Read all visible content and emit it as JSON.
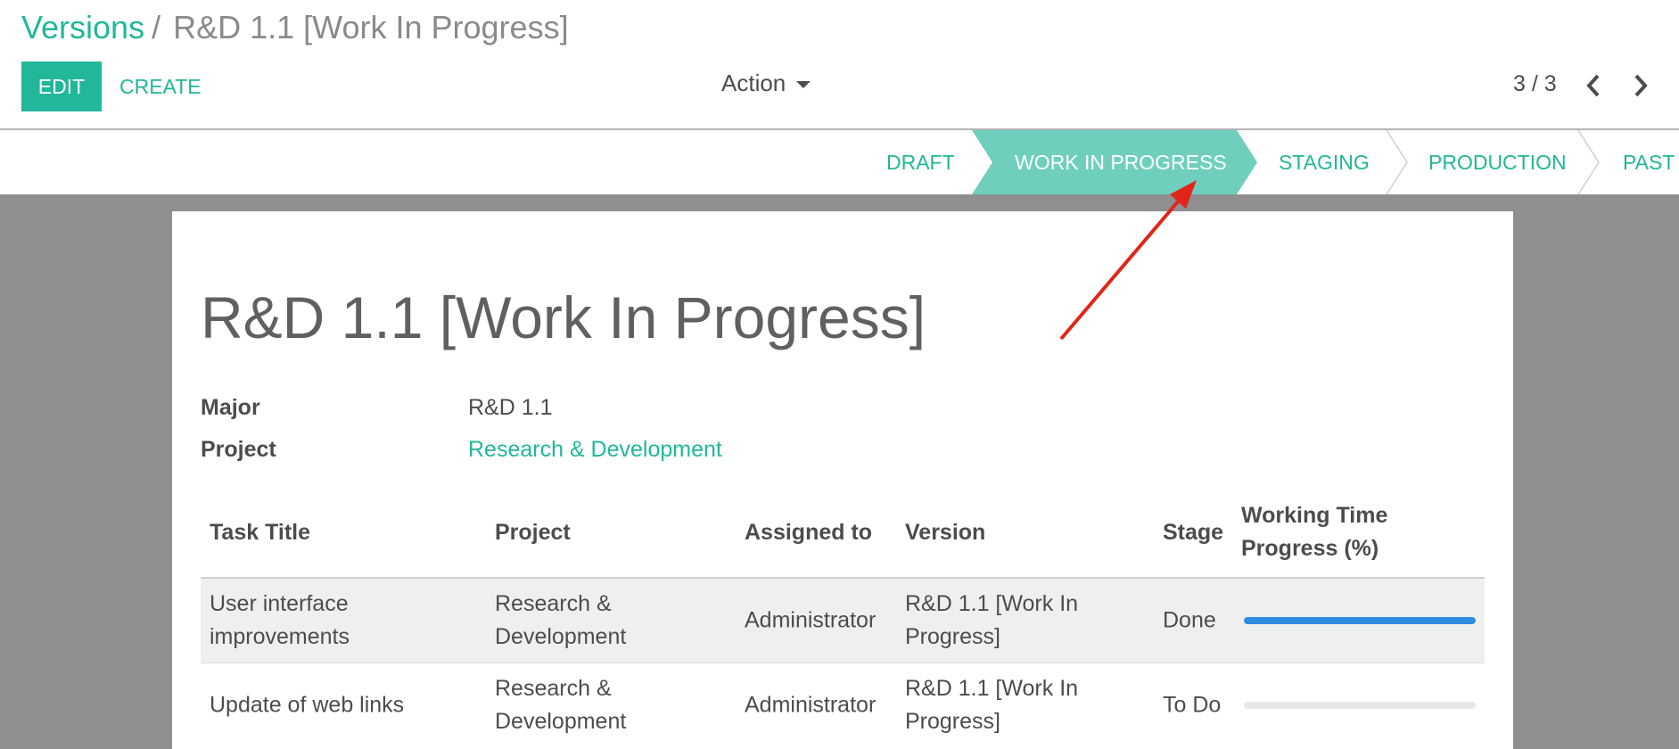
{
  "breadcrumb": {
    "parent": "Versions",
    "separator": "/",
    "current": "R&D 1.1 [Work In Progress]"
  },
  "toolbar": {
    "edit_label": "EDIT",
    "create_label": "CREATE",
    "action_label": "Action"
  },
  "pager": {
    "value": "3 / 3"
  },
  "stages": [
    {
      "label": "DRAFT",
      "active": false
    },
    {
      "label": "WORK IN PROGRESS",
      "active": true
    },
    {
      "label": "STAGING",
      "active": false
    },
    {
      "label": "PRODUCTION",
      "active": false
    },
    {
      "label": "PAST",
      "active": false
    }
  ],
  "record": {
    "title": "R&D 1.1 [Work In Progress]",
    "fields": [
      {
        "label": "Major",
        "value": "R&D 1.1",
        "link": false
      },
      {
        "label": "Project",
        "value": "Research & Development",
        "link": true
      }
    ]
  },
  "table": {
    "headers": {
      "task_title": "Task Title",
      "project": "Project",
      "assigned_to": "Assigned to",
      "version": "Version",
      "stage": "Stage",
      "progress_line1": "Working Time",
      "progress_line2": "Progress (%)"
    },
    "rows": [
      {
        "task_title_1": "User interface",
        "task_title_2": "improvements",
        "project_1": "Research &",
        "project_2": "Development",
        "assigned_to": "Administrator",
        "version_1": "R&D 1.1 [Work In",
        "version_2": "Progress]",
        "stage": "Done",
        "progress": 100
      },
      {
        "task_title": "Update of web links",
        "project_1": "Research &",
        "project_2": "Development",
        "assigned_to": "Administrator",
        "version_1": "R&D 1.1 [Work In",
        "version_2": "Progress]",
        "stage": "To Do",
        "progress": 0
      }
    ]
  },
  "colors": {
    "accent": "#21b799",
    "active_stage": "#6fcfbc",
    "progress": "#2f8de4",
    "annotation_arrow": "#e0261a"
  },
  "icons": {
    "pager_prev": "chevron-left-icon",
    "pager_next": "chevron-right-icon",
    "action_caret": "caret-down-icon"
  }
}
